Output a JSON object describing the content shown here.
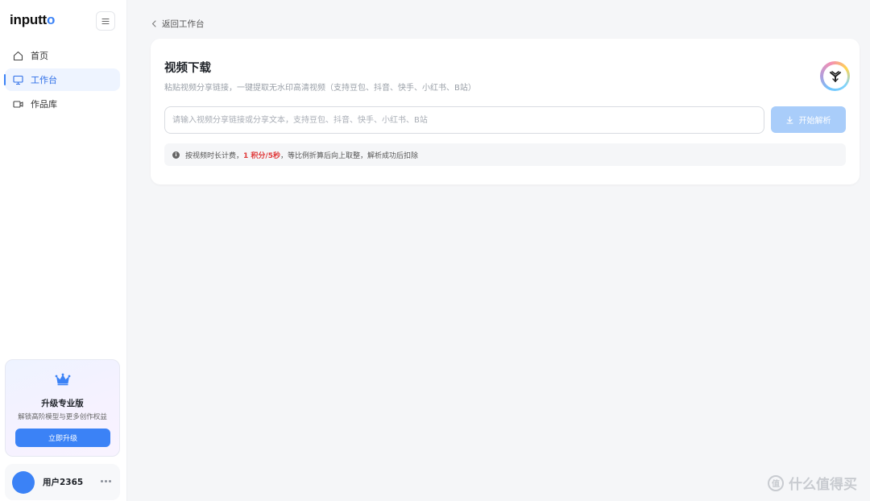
{
  "app": {
    "logo_main": "inputt",
    "logo_accent": "o"
  },
  "sidebar": {
    "items": [
      {
        "label": "首页",
        "icon": "home-icon",
        "active": false
      },
      {
        "label": "工作台",
        "icon": "monitor-icon",
        "active": true
      },
      {
        "label": "作品库",
        "icon": "video-camera-icon",
        "active": false
      }
    ],
    "upgrade": {
      "title": "升级专业版",
      "subtitle": "解锁高阶模型与更多创作权益",
      "button_label": "立即升级",
      "icon": "crown-icon"
    },
    "user": {
      "name": "用户2365",
      "more_icon": "more-horizontal-icon"
    }
  },
  "breadcrumb": {
    "back_label": "返回工作台"
  },
  "panel": {
    "title": "视频下载",
    "subtitle": "粘贴视频分享链接，一键提取无水印高清视频（支持豆包、抖音、快手、小红书、B站）",
    "input_placeholder": "请输入视频分享链接或分享文本，支持豆包、抖音、快手、小红书、B站",
    "input_value": "",
    "parse_button_label": "开始解析",
    "notice": {
      "prefix": "按视频时长计费，",
      "highlight": "1 积分/5秒",
      "suffix": "，等比例折算后向上取整，解析成功后扣除"
    }
  },
  "watermark": {
    "text": "什么值得买"
  },
  "colors": {
    "accent": "#3b82f6",
    "accent_disabled": "#a9cdfa",
    "highlight": "#e03a3a"
  }
}
